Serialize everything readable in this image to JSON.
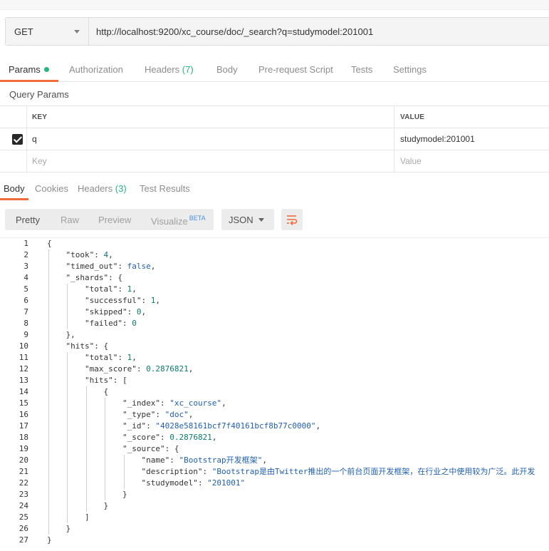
{
  "request": {
    "method": "GET",
    "url": "http://localhost:9200/xc_course/doc/_search?q=studymodel:201001"
  },
  "request_tabs": [
    {
      "label": "Params",
      "count": ""
    },
    {
      "label": "Authorization",
      "count": ""
    },
    {
      "label": "Headers",
      "count": "(7)"
    },
    {
      "label": "Body",
      "count": ""
    },
    {
      "label": "Pre-request Script",
      "count": ""
    },
    {
      "label": "Tests",
      "count": ""
    },
    {
      "label": "Settings",
      "count": ""
    }
  ],
  "query_params": {
    "title": "Query Params",
    "headers": {
      "key": "KEY",
      "value": "VALUE"
    },
    "rows": [
      {
        "key": "q",
        "value": "studymodel:201001",
        "checked": true
      }
    ],
    "placeholder": {
      "key": "Key",
      "value": "Value"
    }
  },
  "response_tabs": [
    {
      "label": "Body",
      "count": ""
    },
    {
      "label": "Cookies",
      "count": ""
    },
    {
      "label": "Headers",
      "count": "(3)"
    },
    {
      "label": "Test Results",
      "count": ""
    }
  ],
  "view_modes": {
    "pretty": "Pretty",
    "raw": "Raw",
    "preview": "Preview",
    "visualize": "Visualize",
    "beta": "BETA"
  },
  "format": "JSON",
  "icons": {
    "dropdown": "chevron-down-icon",
    "wrap": "wrap-lines-icon",
    "check": "check-icon",
    "status": "status-dot-icon"
  },
  "colors": {
    "accent": "#f26b3a",
    "count": "#26b47f",
    "string": "#1f5fb0",
    "number": "#0b7a6e"
  },
  "code_lines": [
    "{",
    "    \"took\": 4,",
    "    \"timed_out\": false,",
    "    \"_shards\": {",
    "        \"total\": 1,",
    "        \"successful\": 1,",
    "        \"skipped\": 0,",
    "        \"failed\": 0",
    "    },",
    "    \"hits\": {",
    "        \"total\": 1,",
    "        \"max_score\": 0.2876821,",
    "        \"hits\": [",
    "            {",
    "                \"_index\": \"xc_course\",",
    "                \"_type\": \"doc\",",
    "                \"_id\": \"4028e58161bcf7f40161bcf8b77c0000\",",
    "                \"_score\": 0.2876821,",
    "                \"_source\": {",
    "                    \"name\": \"Bootstrap开发框架\",",
    "                    \"description\": \"Bootstrap是由Twitter推出的一个前台页面开发框架，在行业之中使用较为广泛。此开发",
    "                    \"studymodel\": \"201001\"",
    "                }",
    "            }",
    "        ]",
    "    }",
    "}"
  ]
}
